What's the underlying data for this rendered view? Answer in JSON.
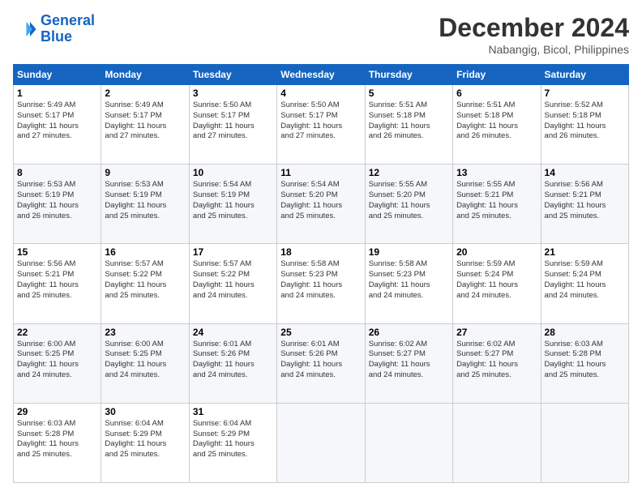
{
  "logo": {
    "line1": "General",
    "line2": "Blue"
  },
  "header": {
    "month": "December 2024",
    "location": "Nabangig, Bicol, Philippines"
  },
  "days_of_week": [
    "Sunday",
    "Monday",
    "Tuesday",
    "Wednesday",
    "Thursday",
    "Friday",
    "Saturday"
  ],
  "weeks": [
    [
      {
        "day": "1",
        "info": "Sunrise: 5:49 AM\nSunset: 5:17 PM\nDaylight: 11 hours\nand 27 minutes."
      },
      {
        "day": "2",
        "info": "Sunrise: 5:49 AM\nSunset: 5:17 PM\nDaylight: 11 hours\nand 27 minutes."
      },
      {
        "day": "3",
        "info": "Sunrise: 5:50 AM\nSunset: 5:17 PM\nDaylight: 11 hours\nand 27 minutes."
      },
      {
        "day": "4",
        "info": "Sunrise: 5:50 AM\nSunset: 5:17 PM\nDaylight: 11 hours\nand 27 minutes."
      },
      {
        "day": "5",
        "info": "Sunrise: 5:51 AM\nSunset: 5:18 PM\nDaylight: 11 hours\nand 26 minutes."
      },
      {
        "day": "6",
        "info": "Sunrise: 5:51 AM\nSunset: 5:18 PM\nDaylight: 11 hours\nand 26 minutes."
      },
      {
        "day": "7",
        "info": "Sunrise: 5:52 AM\nSunset: 5:18 PM\nDaylight: 11 hours\nand 26 minutes."
      }
    ],
    [
      {
        "day": "8",
        "info": "Sunrise: 5:53 AM\nSunset: 5:19 PM\nDaylight: 11 hours\nand 26 minutes."
      },
      {
        "day": "9",
        "info": "Sunrise: 5:53 AM\nSunset: 5:19 PM\nDaylight: 11 hours\nand 25 minutes."
      },
      {
        "day": "10",
        "info": "Sunrise: 5:54 AM\nSunset: 5:19 PM\nDaylight: 11 hours\nand 25 minutes."
      },
      {
        "day": "11",
        "info": "Sunrise: 5:54 AM\nSunset: 5:20 PM\nDaylight: 11 hours\nand 25 minutes."
      },
      {
        "day": "12",
        "info": "Sunrise: 5:55 AM\nSunset: 5:20 PM\nDaylight: 11 hours\nand 25 minutes."
      },
      {
        "day": "13",
        "info": "Sunrise: 5:55 AM\nSunset: 5:21 PM\nDaylight: 11 hours\nand 25 minutes."
      },
      {
        "day": "14",
        "info": "Sunrise: 5:56 AM\nSunset: 5:21 PM\nDaylight: 11 hours\nand 25 minutes."
      }
    ],
    [
      {
        "day": "15",
        "info": "Sunrise: 5:56 AM\nSunset: 5:21 PM\nDaylight: 11 hours\nand 25 minutes."
      },
      {
        "day": "16",
        "info": "Sunrise: 5:57 AM\nSunset: 5:22 PM\nDaylight: 11 hours\nand 25 minutes."
      },
      {
        "day": "17",
        "info": "Sunrise: 5:57 AM\nSunset: 5:22 PM\nDaylight: 11 hours\nand 24 minutes."
      },
      {
        "day": "18",
        "info": "Sunrise: 5:58 AM\nSunset: 5:23 PM\nDaylight: 11 hours\nand 24 minutes."
      },
      {
        "day": "19",
        "info": "Sunrise: 5:58 AM\nSunset: 5:23 PM\nDaylight: 11 hours\nand 24 minutes."
      },
      {
        "day": "20",
        "info": "Sunrise: 5:59 AM\nSunset: 5:24 PM\nDaylight: 11 hours\nand 24 minutes."
      },
      {
        "day": "21",
        "info": "Sunrise: 5:59 AM\nSunset: 5:24 PM\nDaylight: 11 hours\nand 24 minutes."
      }
    ],
    [
      {
        "day": "22",
        "info": "Sunrise: 6:00 AM\nSunset: 5:25 PM\nDaylight: 11 hours\nand 24 minutes."
      },
      {
        "day": "23",
        "info": "Sunrise: 6:00 AM\nSunset: 5:25 PM\nDaylight: 11 hours\nand 24 minutes."
      },
      {
        "day": "24",
        "info": "Sunrise: 6:01 AM\nSunset: 5:26 PM\nDaylight: 11 hours\nand 24 minutes."
      },
      {
        "day": "25",
        "info": "Sunrise: 6:01 AM\nSunset: 5:26 PM\nDaylight: 11 hours\nand 24 minutes."
      },
      {
        "day": "26",
        "info": "Sunrise: 6:02 AM\nSunset: 5:27 PM\nDaylight: 11 hours\nand 24 minutes."
      },
      {
        "day": "27",
        "info": "Sunrise: 6:02 AM\nSunset: 5:27 PM\nDaylight: 11 hours\nand 25 minutes."
      },
      {
        "day": "28",
        "info": "Sunrise: 6:03 AM\nSunset: 5:28 PM\nDaylight: 11 hours\nand 25 minutes."
      }
    ],
    [
      {
        "day": "29",
        "info": "Sunrise: 6:03 AM\nSunset: 5:28 PM\nDaylight: 11 hours\nand 25 minutes."
      },
      {
        "day": "30",
        "info": "Sunrise: 6:04 AM\nSunset: 5:29 PM\nDaylight: 11 hours\nand 25 minutes."
      },
      {
        "day": "31",
        "info": "Sunrise: 6:04 AM\nSunset: 5:29 PM\nDaylight: 11 hours\nand 25 minutes."
      },
      null,
      null,
      null,
      null
    ]
  ]
}
